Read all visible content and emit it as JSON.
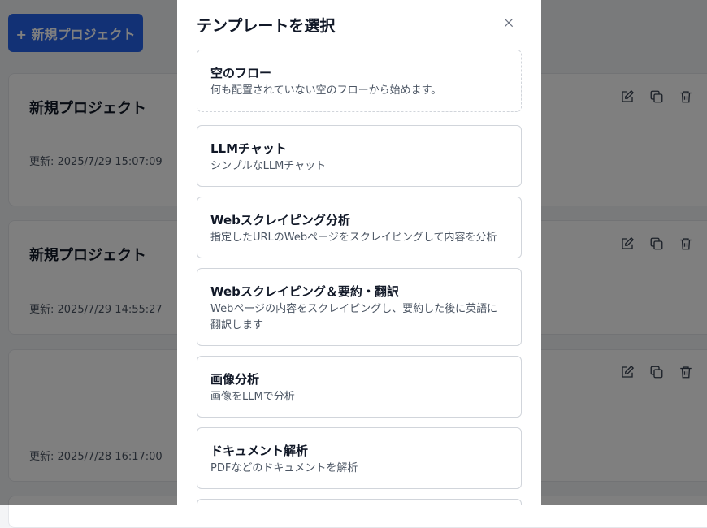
{
  "background": {
    "new_project_label": "+ 新規プロジェクト",
    "projects": [
      {
        "title": "新規プロジェクト",
        "updated": "更新: 2025/7/29 15:07:09"
      },
      {
        "title": "新規プロジェクト",
        "updated": "更新: 2025/7/29 14:55:27"
      },
      {
        "title": "",
        "updated": "更新: 2025/7/28 16:17:00"
      }
    ]
  },
  "modal": {
    "title": "テンプレートを選択",
    "templates": [
      {
        "name": "空のフロー",
        "description": "何も配置されていない空のフローから始めます。"
      },
      {
        "name": "LLMチャット",
        "description": "シンプルなLLMチャット"
      },
      {
        "name": "Webスクレイピング分析",
        "description": "指定したURLのWebページをスクレイピングして内容を分析"
      },
      {
        "name": "Webスクレイピング＆要約・翻訳",
        "description": "Webページの内容をスクレイピングし、要約した後に英語に翻訳します"
      },
      {
        "name": "画像分析",
        "description": "画像をLLMで分析"
      },
      {
        "name": "ドキュメント解析",
        "description": "PDFなどのドキュメントを解析"
      }
    ]
  }
}
